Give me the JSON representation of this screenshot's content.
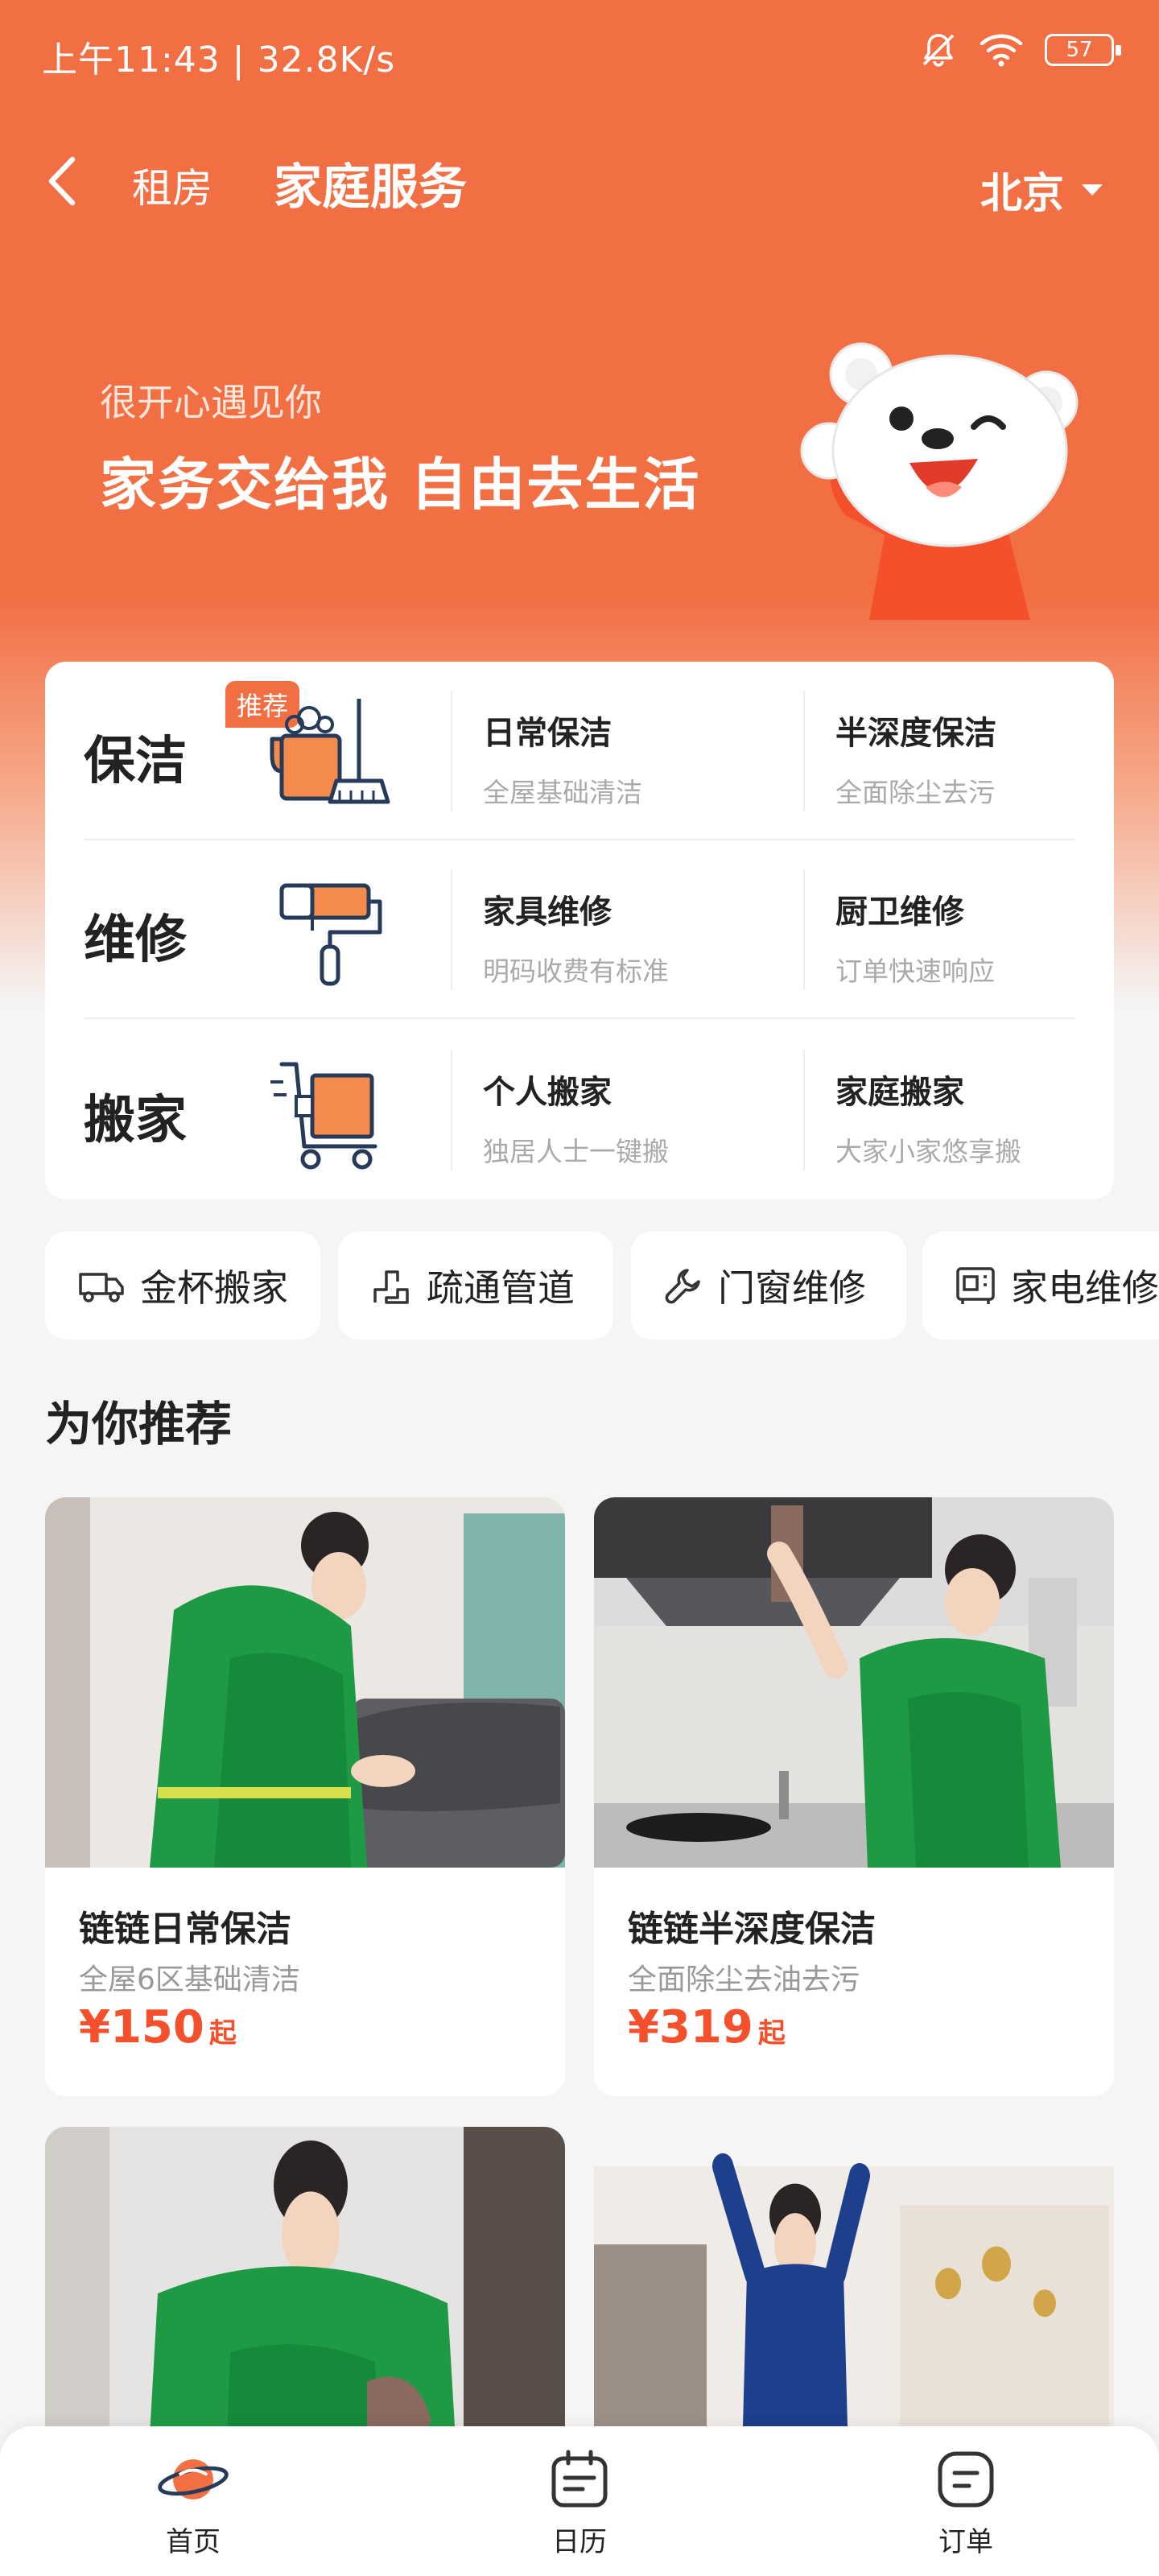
{
  "status_bar": {
    "time_speed": "上午11:43 | 32.8K/s",
    "battery": "57",
    "icons": [
      "mute-bell-icon",
      "wifi-icon",
      "battery-icon"
    ]
  },
  "header": {
    "back_icon": "back-arrow-icon",
    "nav_rent": "租房",
    "title": "家庭服务",
    "city": "北京"
  },
  "hero": {
    "greeting": "很开心遇见你",
    "slogan": "家务交给我 自由去生活"
  },
  "services": [
    {
      "category": "保洁",
      "badge": "推荐",
      "icon": "cleaning-bucket-icon",
      "items": [
        {
          "title": "日常保洁",
          "desc": "全屋基础清洁"
        },
        {
          "title": "半深度保洁",
          "desc": "全面除尘去污"
        }
      ]
    },
    {
      "category": "维修",
      "badge": "",
      "icon": "paint-roller-icon",
      "items": [
        {
          "title": "家具维修",
          "desc": "明码收费有标准"
        },
        {
          "title": "厨卫维修",
          "desc": "订单快速响应"
        }
      ]
    },
    {
      "category": "搬家",
      "badge": "",
      "icon": "moving-cart-icon",
      "items": [
        {
          "title": "个人搬家",
          "desc": "独居人士一键搬"
        },
        {
          "title": "家庭搬家",
          "desc": "大家小家悠享搬"
        }
      ]
    }
  ],
  "quick_services": [
    {
      "label": "金杯搬家",
      "icon": "van-icon"
    },
    {
      "label": "疏通管道",
      "icon": "pipe-icon"
    },
    {
      "label": "门窗维修",
      "icon": "wrench-icon"
    },
    {
      "label": "家电维修",
      "icon": "appliance-icon"
    }
  ],
  "recommend": {
    "title": "为你推荐",
    "cards": [
      {
        "name": "链链日常保洁",
        "desc": "全屋6区基础清洁",
        "price": "¥150",
        "unit": "起"
      },
      {
        "name": "链链半深度保洁",
        "desc": "全面除尘去油去污",
        "price": "¥319",
        "unit": "起"
      },
      {
        "name": "",
        "desc": "",
        "price": "",
        "unit": ""
      },
      {
        "name": "",
        "desc": "",
        "price": "",
        "unit": ""
      }
    ]
  },
  "tab_bar": {
    "tabs": [
      {
        "label": "首页",
        "icon": "planet-home-icon",
        "active": true
      },
      {
        "label": "日历",
        "icon": "calendar-icon",
        "active": false
      },
      {
        "label": "订单",
        "icon": "order-icon",
        "active": false
      }
    ]
  },
  "colors": {
    "brand_orange": "#f26f44",
    "price_red": "#f4502c",
    "uniform_green": "#1f9a44",
    "page_bg": "#f5f5f5"
  }
}
